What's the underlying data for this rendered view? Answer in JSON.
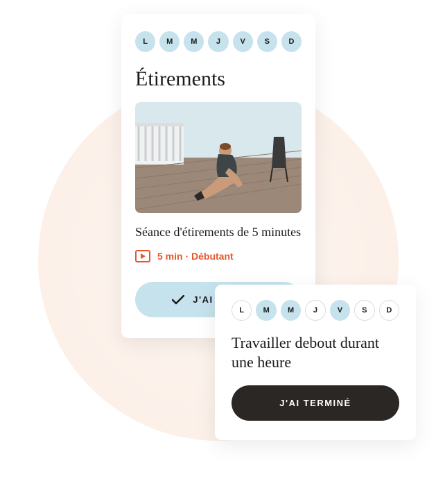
{
  "days": [
    "L",
    "M",
    "M",
    "J",
    "V",
    "S",
    "D"
  ],
  "card_main": {
    "day_states": [
      true,
      true,
      true,
      true,
      true,
      true,
      true
    ],
    "title": "Étirements",
    "session_title": "Séance d'étirements de 5 minutes",
    "meta": "5 min · Débutant",
    "button_label": "J'AI TERMINÉ"
  },
  "card_small": {
    "day_states": [
      false,
      true,
      true,
      false,
      true,
      false,
      false
    ],
    "title": "Travailler debout durant une heure",
    "button_label": "J'AI TERMINÉ"
  }
}
